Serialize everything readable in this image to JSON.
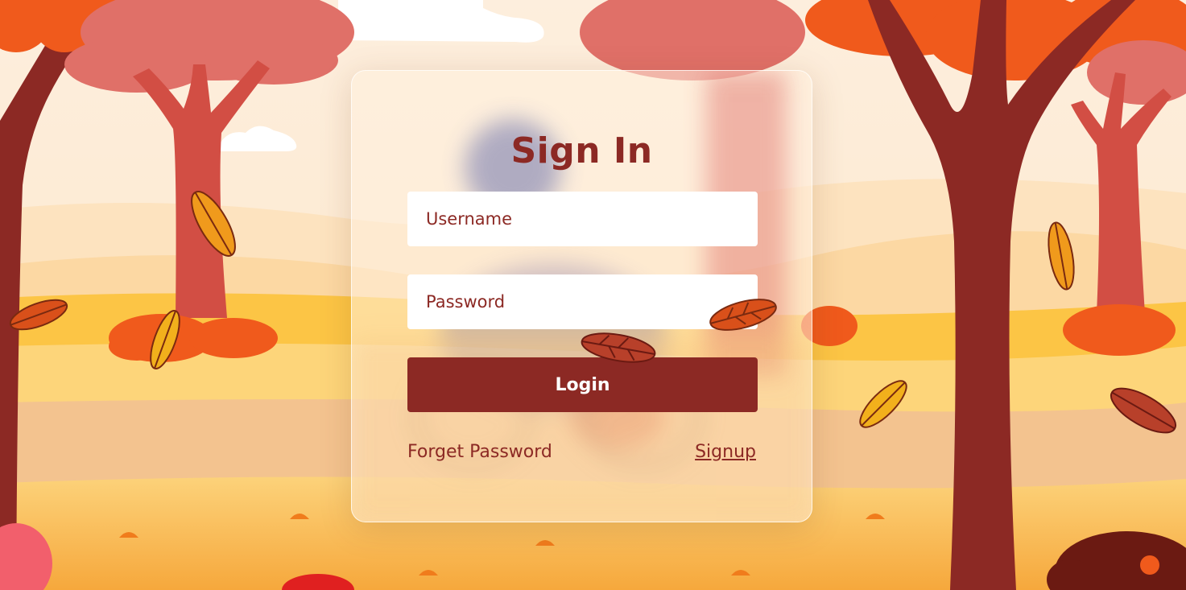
{
  "form": {
    "title": "Sign In",
    "username_placeholder": "Username",
    "password_placeholder": "Password",
    "login_label": "Login",
    "forget_password_label": "Forget Password",
    "signup_label": "Signup"
  },
  "colors": {
    "brand": "#8c2924",
    "field_background": "#ffffff",
    "sky": "#fff3e2",
    "ground": "#f7b14a",
    "tree_trunk_dark": "#8c2924",
    "tree_trunk_light": "#d24e44",
    "foliage_pink": "#e07068",
    "foliage_orange": "#f05a1c"
  },
  "scene": {
    "season": "autumn",
    "decorations": [
      "tree-icon",
      "falling-leaf-icon",
      "bush-icon",
      "cloud-icon",
      "grass-sprout-icon"
    ]
  }
}
